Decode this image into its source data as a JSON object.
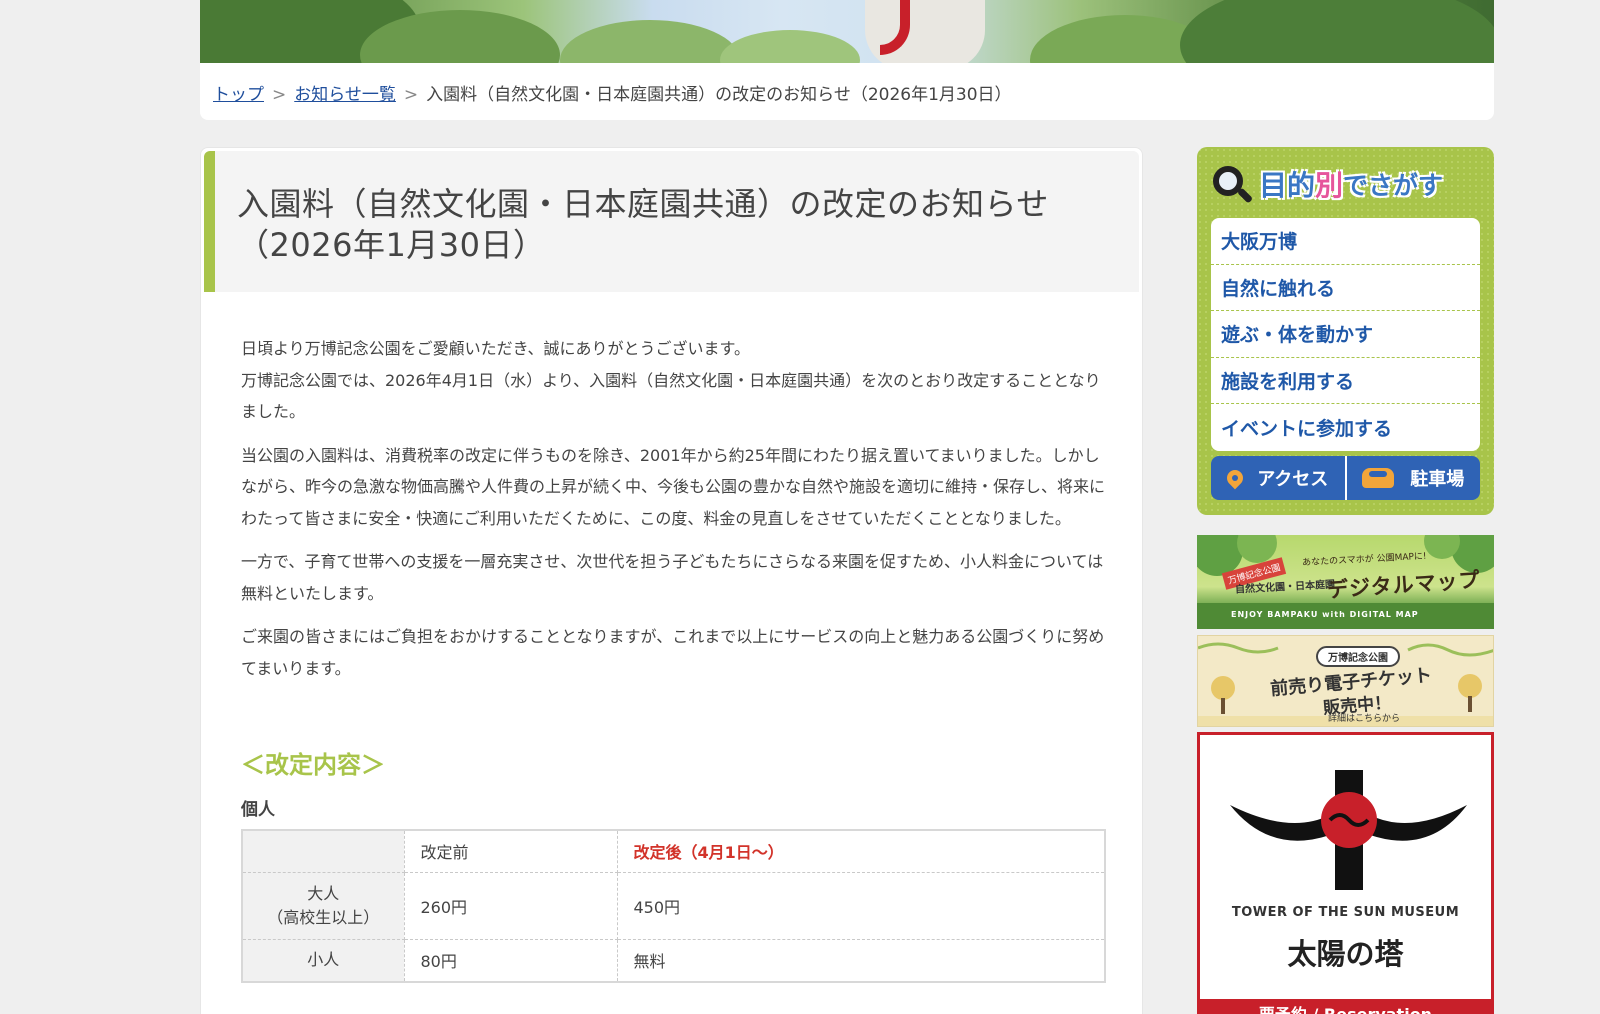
{
  "breadcrumb": {
    "home": "トップ",
    "news_list": "お知らせ一覧",
    "current": "入園料（自然文化園・日本庭園共通）の改定のお知らせ（2026年1月30日）",
    "separator": ">"
  },
  "article": {
    "title_line1": "入園料（自然文化園・日本庭園共通）の改定のお知らせ",
    "title_line2": "（2026年1月30日）",
    "paragraphs": [
      "日頃より万博記念公園をご愛顧いただき、誠にありがとうございます。\n万博記念公園では、2026年4月1日（水）より、入園料（自然文化園・日本庭園共通）を次のとおり改定することとなりました。",
      "当公園の入園料は、消費税率の改定に伴うものを除き、2001年から約25年間にわたり据え置いてまいりました。しかしながら、昨今の急激な物価高騰や人件費の上昇が続く中、今後も公園の豊かな自然や施設を適切に維持・保存し、将来にわたって皆さまに安全・快適にご利用いただくために、この度、料金の見直しをさせていただくこととなりました。",
      "一方で、子育て世帯への支援を一層充実させ、次世代を担う子どもたちにさらなる来園を促すため、小人料金については無料といたします。",
      "ご来園の皆さまにはご負担をおかけすることとなりますが、これまで以上にサービスの向上と魅力ある公園づくりに努めてまいります。"
    ],
    "section_heading": "＜改定内容＞",
    "sub_heading": "個人",
    "table": {
      "header": {
        "blank": "",
        "before": "改定前",
        "after": "改定後（4月1日〜）"
      },
      "rows": [
        {
          "label_line1": "大人",
          "label_line2": "（高校生以上）",
          "before": "260円",
          "after": "450円"
        },
        {
          "label_line1": "小人",
          "label_line2": "",
          "before": "80円",
          "after": "無料"
        }
      ]
    }
  },
  "sidebar": {
    "purpose_title": {
      "part1": "目的",
      "part2": "別",
      "part3": "でさがす"
    },
    "items": [
      {
        "label": "大阪万博"
      },
      {
        "label": "自然に触れる"
      },
      {
        "label": "遊ぶ・体を動かす"
      },
      {
        "label": "施設を利用する"
      },
      {
        "label": "イベントに参加する"
      }
    ],
    "access_label": "アクセス",
    "parking_label": "駐車場",
    "banners": {
      "map": {
        "tag": "万博記念公園",
        "small": "あなたのスマホが 公園MAPに!",
        "sub": "自然文化園・日本庭園",
        "title": "デジタルマップ",
        "foot": "ENJOY BAMPAKU with DIGITAL MAP"
      },
      "ticket": {
        "badge": "万博記念公園",
        "line1": "前売り電子チケット",
        "line2": "販売中！",
        "note": "詳細はこちらから"
      },
      "sun": {
        "caption": "TOWER OF THE SUN MUSEUM",
        "name": "太陽の塔",
        "strip": "要予約 / Reservation"
      }
    }
  },
  "colors": {
    "accent_green": "#a8c44a",
    "link_blue": "#1f4e9c",
    "nav_blue": "#2f63b5",
    "after_red": "#d2332a",
    "sun_red": "#c8202a"
  }
}
